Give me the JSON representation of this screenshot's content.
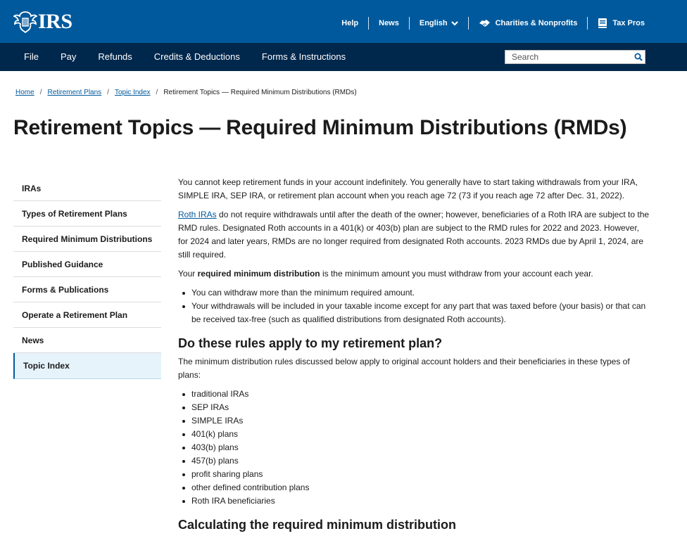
{
  "header": {
    "logo_text": "IRS",
    "utility": [
      {
        "label": "Help"
      },
      {
        "label": "News"
      },
      {
        "label": "English"
      },
      {
        "label": "Charities & Nonprofits"
      },
      {
        "label": "Tax Pros"
      }
    ]
  },
  "nav": {
    "items": [
      "File",
      "Pay",
      "Refunds",
      "Credits & Deductions",
      "Forms & Instructions"
    ],
    "search_placeholder": "Search"
  },
  "breadcrumb": [
    "Home",
    "Retirement Plans",
    "Topic Index",
    "Retirement Topics — Required Minimum Distributions (RMDs)"
  ],
  "page_title": "Retirement Topics — Required Minimum Distributions (RMDs)",
  "sidebar": {
    "items": [
      "IRAs",
      "Types of Retirement Plans",
      "Required Minimum Distributions",
      "Published Guidance",
      "Forms & Publications",
      "Operate a Retirement Plan",
      "News",
      "Topic Index"
    ],
    "active": "Topic Index"
  },
  "content": {
    "p1": "You cannot keep retirement funds in your account indefinitely. You generally have to start taking withdrawals from your IRA, SIMPLE IRA, SEP IRA, or retirement plan account when you reach age 72 (73 if you reach age 72 after Dec. 31, 2022).",
    "p2_link": "Roth IRAs",
    "p2_rest": " do not require withdrawals until after the death of the owner; however, beneficiaries of a Roth IRA are subject to the RMD rules. Designated Roth accounts in a 401(k) or 403(b) plan are subject to the RMD rules for 2022 and 2023. However, for 2024 and later years, RMDs are no longer required from designated Roth accounts. 2023 RMDs due by April 1, 2024, are still required.",
    "p3_pre": "Your ",
    "p3_bold": "required minimum distribution",
    "p3_post": " is the minimum amount you must withdraw from your account each year.",
    "bullets1": [
      "You can withdraw more than the minimum required amount.",
      "Your withdrawals will be included in your taxable income except for any part that was taxed before (your basis) or that can be received tax-free (such as qualified distributions from designated Roth accounts)."
    ],
    "h2_1": "Do these rules apply to my retirement plan?",
    "p4": "The minimum distribution rules discussed below apply to original account holders and their beneficiaries in these types of plans:",
    "bullets2": [
      "traditional IRAs",
      "SEP IRAs",
      "SIMPLE IRAs",
      "401(k) plans",
      "403(b) plans",
      "457(b) plans",
      "profit sharing plans",
      "other defined contribution plans",
      "Roth IRA beneficiaries"
    ],
    "h2_2": "Calculating the required minimum distribution"
  }
}
